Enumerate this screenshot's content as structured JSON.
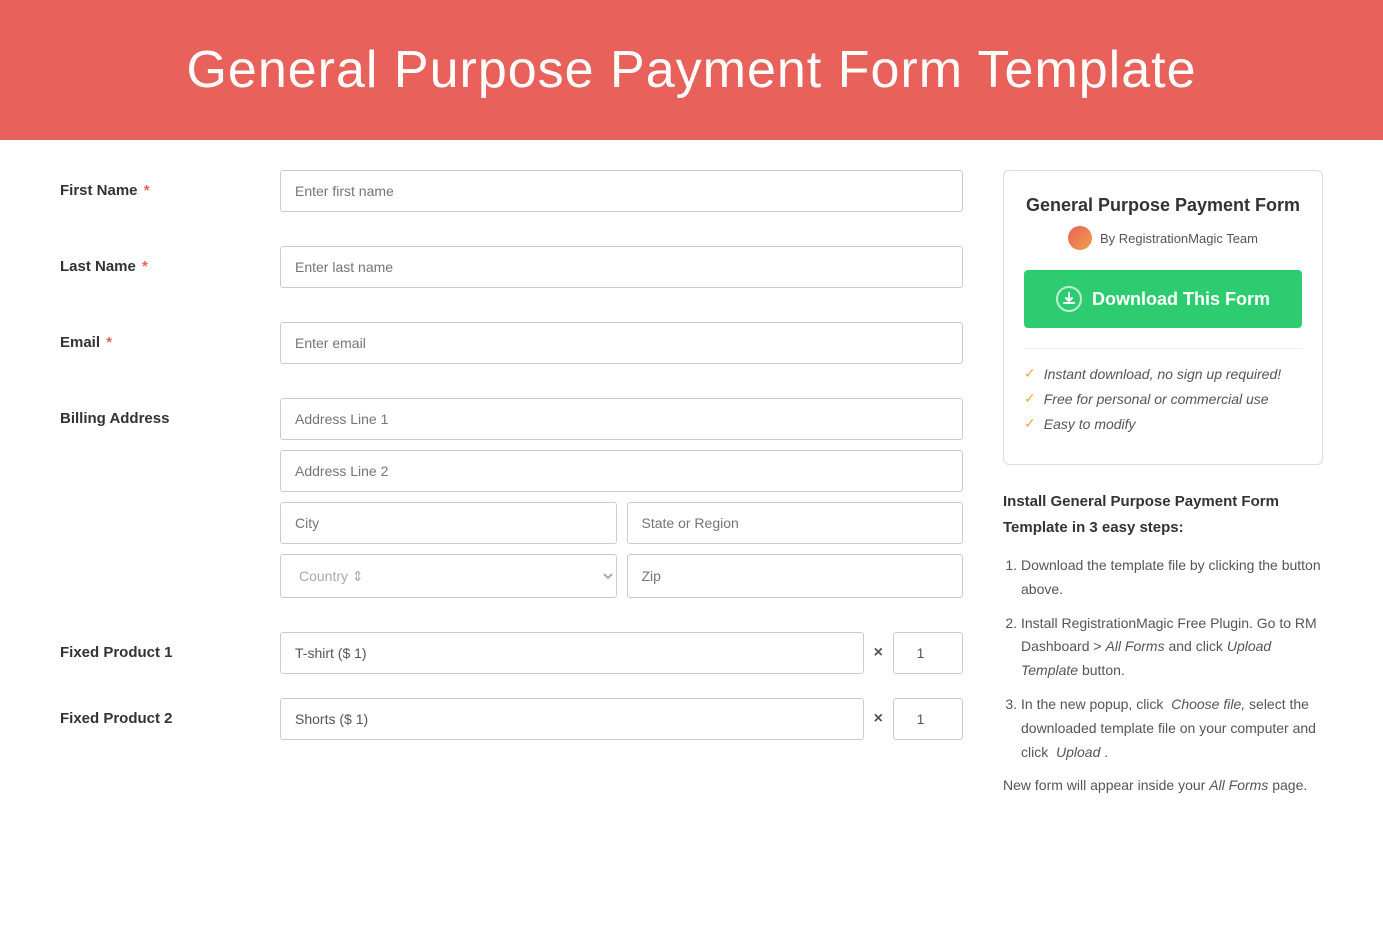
{
  "header": {
    "title": "General Purpose Payment Form Template"
  },
  "form": {
    "fields": [
      {
        "label": "First Name",
        "required": true,
        "placeholder": "Enter first name",
        "type": "text",
        "name": "first-name-field"
      },
      {
        "label": "Last Name",
        "required": true,
        "placeholder": "Enter last name",
        "type": "text",
        "name": "last-name-field"
      },
      {
        "label": "Email",
        "required": true,
        "placeholder": "Enter email",
        "type": "email",
        "name": "email-field"
      }
    ],
    "billing_address": {
      "label": "Billing Address",
      "address_line1_placeholder": "Address Line 1",
      "address_line2_placeholder": "Address Line 2",
      "city_placeholder": "City",
      "state_placeholder": "State or Region",
      "country_placeholder": "Country",
      "zip_placeholder": "Zip"
    },
    "products": [
      {
        "label": "Fixed Product 1",
        "value": "T-shirt ($ 1)",
        "qty": "1",
        "name": "product-1"
      },
      {
        "label": "Fixed Product 2",
        "value": "Shorts ($ 1)",
        "qty": "1",
        "name": "product-2"
      }
    ]
  },
  "sidebar": {
    "card": {
      "title": "General Purpose Payment Form",
      "author": "By RegistrationMagic Team",
      "download_button_label": "Download This Form",
      "features": [
        "Instant download, no sign up required!",
        "Free for personal or commercial use",
        "Easy to modify"
      ]
    },
    "instructions": {
      "title": "Install General Purpose Payment Form Template in 3 easy steps:",
      "steps": [
        "Download the template file by clicking the button above.",
        "Install RegistrationMagic Free Plugin. Go to RM Dashboard > All Forms and click Upload Template button.",
        "In the new popup, click  Choose file, select the downloaded template file on your computer and click  Upload ."
      ],
      "footer_note": "New form will appear inside your All Forms page."
    }
  }
}
